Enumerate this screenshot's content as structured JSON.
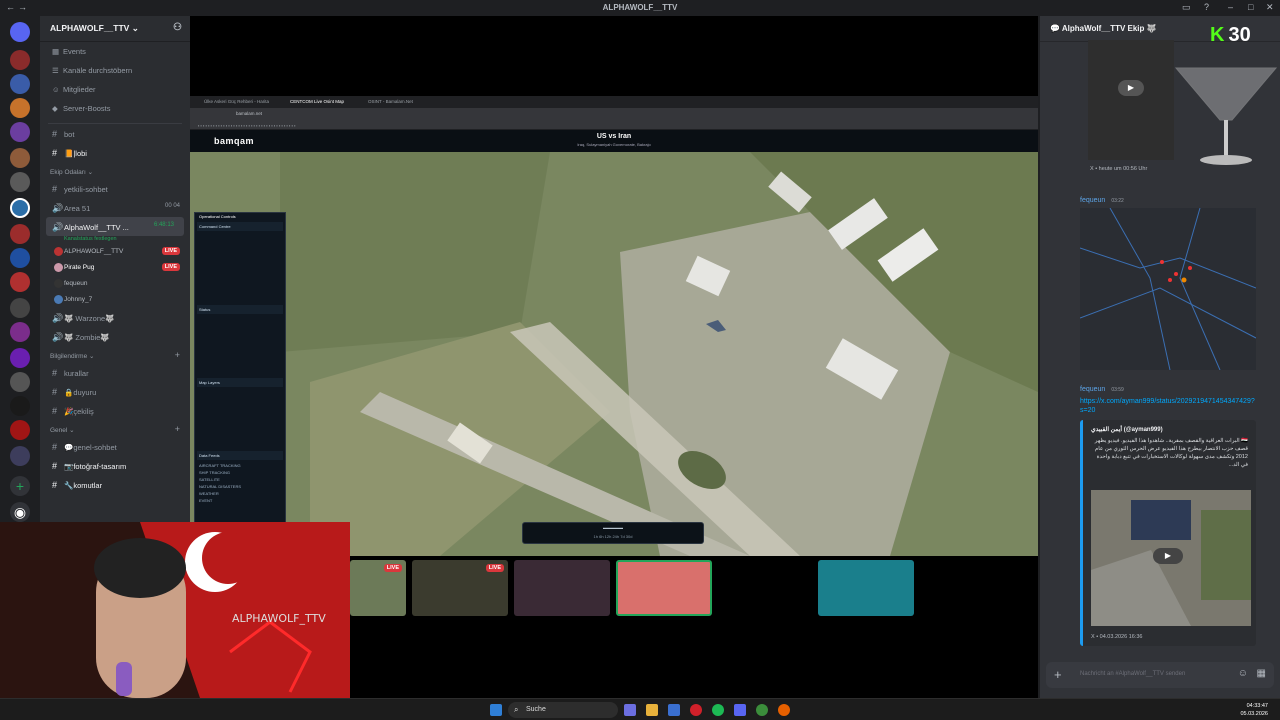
{
  "window": {
    "title": "ALPHAWOLF__TTV"
  },
  "guild": {
    "name": "ALPHAWOLF__TTV",
    "nav": [
      "Events",
      "Kanäle durchstöbern",
      "Mitglieder",
      "Server-Boosts"
    ],
    "top_channels": [
      "bot",
      "📙|lobi"
    ],
    "categories": {
      "ekip": "Ekip Odaları",
      "bilgi": "Bilgilendirme",
      "genel": "Genel"
    },
    "ekip_channels": [
      "yetkili-sohbet",
      "Area 51"
    ],
    "area51_badge": "00 04",
    "voice_channel": {
      "name": "AlphaWolf__TTV ...",
      "timer": "6:48:13",
      "status": "Kanalstatus festlegen"
    },
    "voice_users": [
      {
        "name": "ALPHAWOLF__TTV",
        "live": "LIVE"
      },
      {
        "name": "Pirate Pug",
        "live": "LIVE"
      },
      {
        "name": "fequeun",
        "live": ""
      },
      {
        "name": "Johnny_7",
        "live": ""
      }
    ],
    "more_voice": [
      "🐺 Warzone🐺",
      "🐺 Zombie🐺"
    ],
    "bilgi_channels": [
      "kurallar",
      "🔒duyuru",
      "🎉çekiliş"
    ],
    "genel_channels": [
      "💬genel-sohbet",
      "📷fotoğraf-tasarım",
      "🔧komutlar"
    ]
  },
  "stream": {
    "browser_tabs": [
      "Ülke Askeri Güç Rehberi - Harita",
      "CENTCOM Live Osint Map",
      "OSINT - Bamalam.Net"
    ],
    "address": "bamalam.net",
    "app_logo": "bamqam",
    "map_title": "US vs Iran",
    "map_sub": "Iraq, Sulaymaniyah Governorate, Bakrajo",
    "panel": {
      "title": "Operational Controls",
      "sections": [
        "Command Centre",
        "Status",
        "Map Layers",
        "Data Feeds"
      ],
      "feeds": [
        "AIRCRAFT TRACKING",
        "SHIP TRACKING",
        "SATELLITE",
        "NATURAL DISASTERS",
        "WEATHER",
        "EVENT"
      ]
    },
    "timebar_labels": "1h  6h  12h  24h  7d  30d"
  },
  "right": {
    "channel": "AlphaWolf__TTV Ekip 🐺",
    "kick_count": "30",
    "first_time": "heute um 00:56 Uhr",
    "msg1": {
      "author": "fequeun",
      "time": "03:22"
    },
    "msg2": {
      "author": "fequeun",
      "time": "03:59",
      "link": "https://x.com/ayman999/status/2029219471454347429?s=20"
    },
    "embed": {
      "author": "أيمن القبيدي (@ayman999)",
      "text": "🇮🇶 البرات العراقية والقصف بمقرية.. شاهدوا هذا الفيديو. فيديو يظهر قصف حزب الانتصار بيطرح هذا الفيديو عرض الحرس الثوري من عام 2012 وتكشف مدى سهولة لوكالات الاستخبارات في تتبع دبابة واحدة في الد...",
      "footer": "X • 04.03.2026 16:36"
    },
    "composer_placeholder": "Nachricht an #AlphaWolf__TTV senden"
  },
  "taskbar": {
    "search": "Suche",
    "time": "04:33:47",
    "date": "05.03.2026"
  },
  "colors": {
    "discord_bg": "#313338",
    "accent": "#5865f2",
    "live": "#da373c",
    "kick_green": "#53fc18"
  }
}
